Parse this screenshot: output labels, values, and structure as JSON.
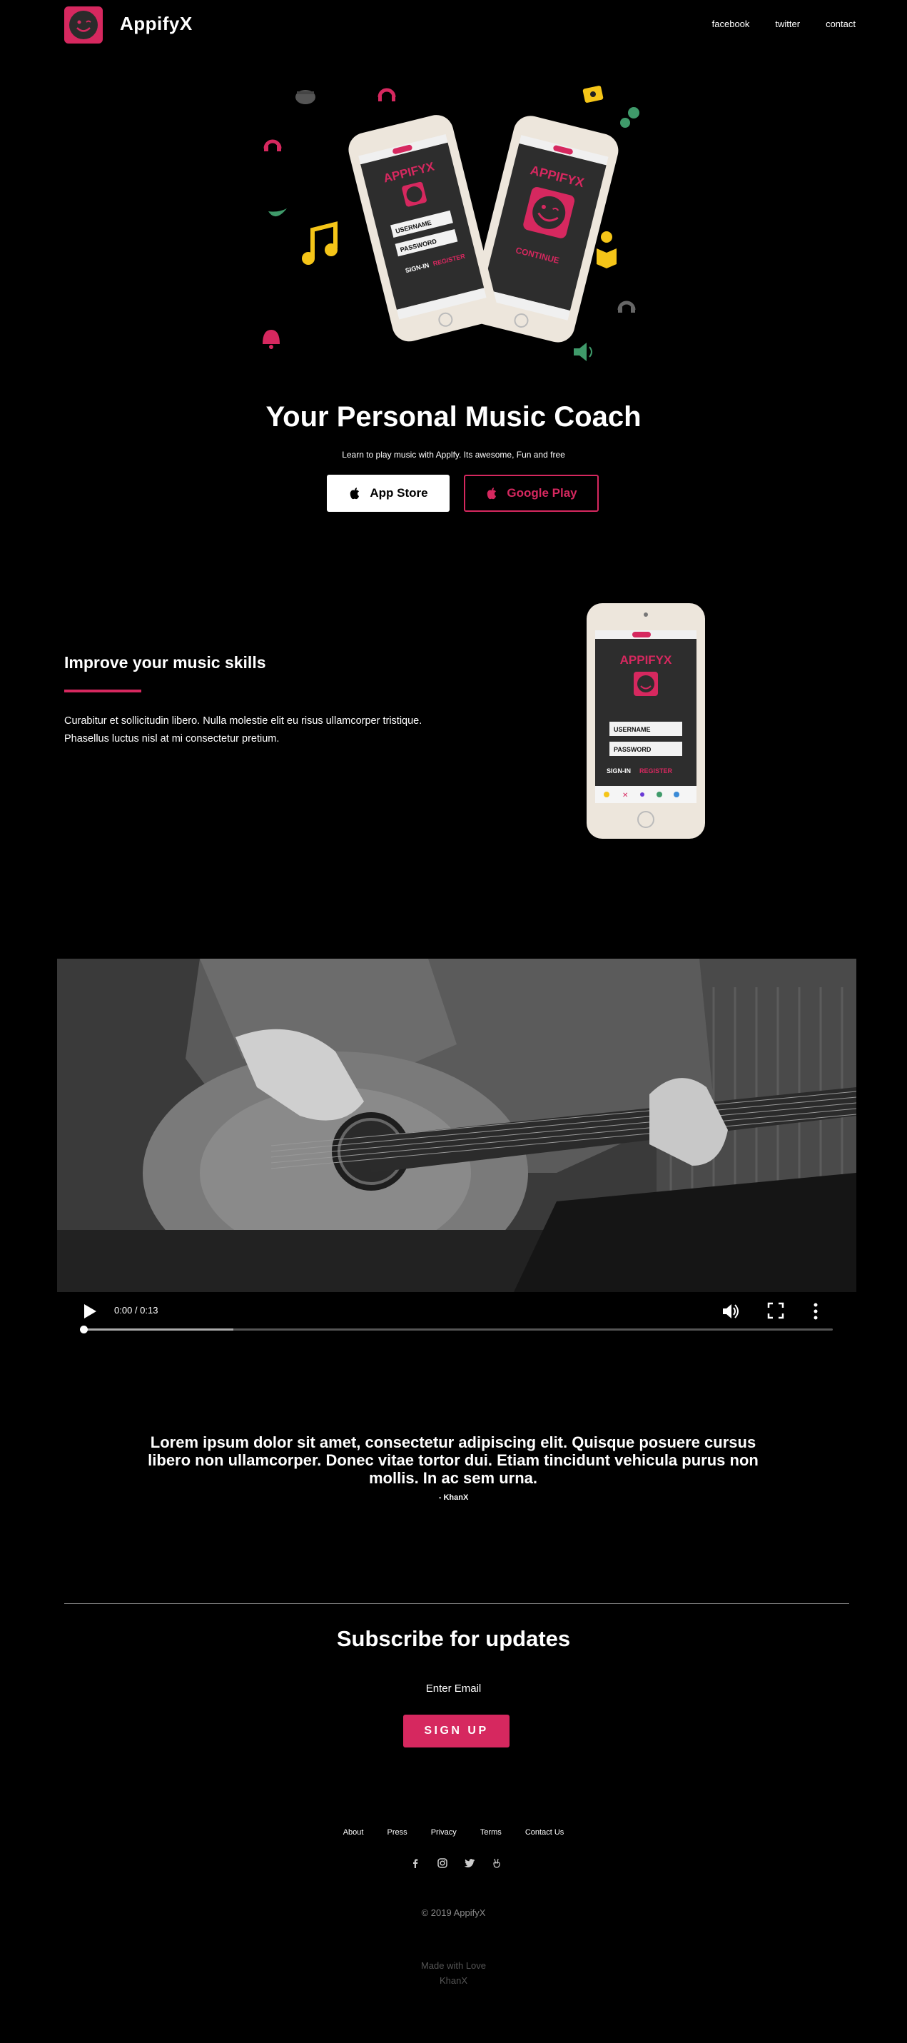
{
  "nav": {
    "brand": "AppifyX",
    "links": [
      "facebook",
      "twitter",
      "contact"
    ]
  },
  "hero": {
    "title": "Your Personal Music Coach",
    "subtitle": "Learn to play music with Applfy. Its awesome, Fun and free",
    "app_store_label": "App Store",
    "google_play_label": "Google Play",
    "phone_left": {
      "app_name": "APPIFYX",
      "username": "USERNAME",
      "password": "PASSWORD",
      "signin": "SIGN-IN",
      "register": "REGISTER"
    },
    "phone_right": {
      "app_name": "APPIFYX",
      "continue": "CONTINUE"
    }
  },
  "feature": {
    "title": "Improve your music skills",
    "text": " Curabitur et sollicitudin libero. Nulla molestie elit eu risus ullamcorper tristique. Phasellus luctus nisl at mi consectetur pretium.",
    "phone": {
      "app_name": "APPIFYX",
      "username": "USERNAME",
      "password": "PASSWORD",
      "signin": "SIGN-IN",
      "register": "REGISTER"
    }
  },
  "video": {
    "time": "0:00 / 0:13",
    "progress_buffered": 0.2
  },
  "quote": {
    "text": "Lorem ipsum dolor sit amet, consectetur adipiscing elit. Quisque posuere cursus libero non ullamcorper. Donec vitae tortor dui. Etiam tincidunt vehicula purus non mollis. In ac sem urna.",
    "author": "- KhanX"
  },
  "subscribe": {
    "title": "Subscribe for updates",
    "email_label": "Enter Email",
    "signup_label": "SIGN UP"
  },
  "footer": {
    "links": [
      "About",
      "Press",
      "Privacy",
      "Terms",
      "Contact Us"
    ],
    "social_icons": [
      "facebook-icon",
      "instagram-icon",
      "twitter-icon",
      "victory-hand-icon"
    ],
    "copyright": "© 2019 AppifyX",
    "made_with_line1": "Made with Love",
    "made_with_line2": "KhanX"
  },
  "colors": {
    "accent": "#d6285f",
    "background": "#000000",
    "text": "#ffffff"
  }
}
